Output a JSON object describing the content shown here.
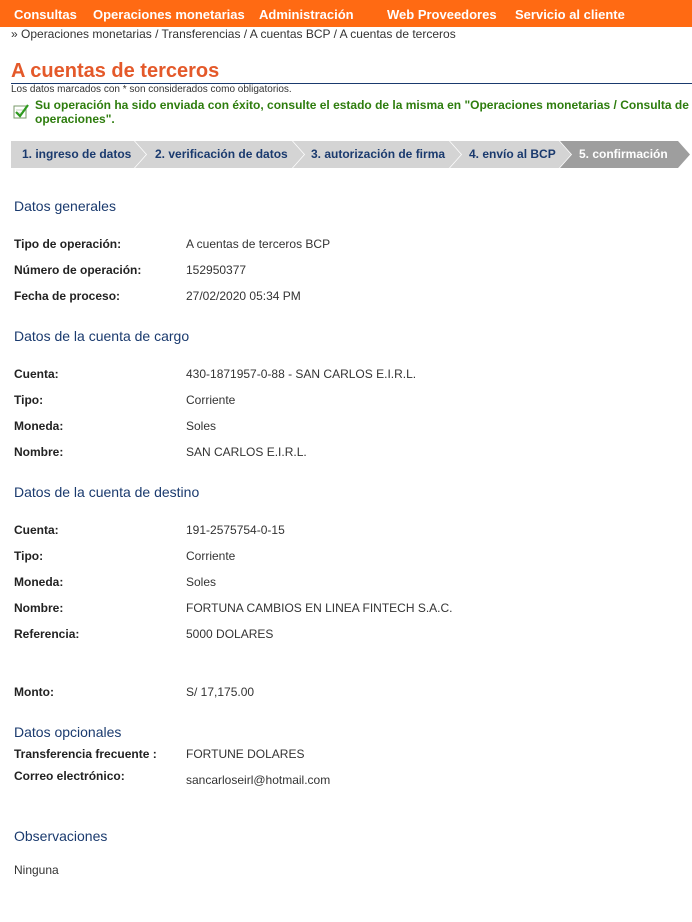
{
  "topnav": {
    "items": [
      "Consultas",
      "Operaciones monetarias",
      "Administración",
      "Web Proveedores",
      "Servicio al cliente"
    ]
  },
  "breadcrumb": "» Operaciones monetarias / Transferencias / A cuentas BCP / A cuentas de terceros",
  "page_title": "A cuentas de terceros",
  "required_note": "Los datos marcados con * son considerados como obligatorios.",
  "success": {
    "line1": "Su operación ha sido enviada con éxito, consulte el estado de la misma en \"Operaciones monetarias / Consulta de",
    "line2": "operaciones\"."
  },
  "steps": [
    "1. ingreso de datos",
    "2. verificación de datos",
    "3. autorización de firma",
    "4. envío al BCP",
    "5. confirmación"
  ],
  "colors": {
    "accent": "#ff6a13",
    "title": "#e4592a",
    "navy": "#1a3a6e",
    "success": "#2e7d0e",
    "step_inactive": "#d4d4d4",
    "step_active": "#9e9e9e"
  },
  "datos_generales": {
    "title": "Datos generales",
    "tipo_label": "Tipo de operación:",
    "tipo_value": "A cuentas de terceros BCP",
    "numero_label": "Número de operación:",
    "numero_value": "152950377",
    "fecha_label": "Fecha de proceso:",
    "fecha_value": "27/02/2020 05:34 PM"
  },
  "cuenta_cargo": {
    "title": "Datos de la cuenta de cargo",
    "cuenta_label": "Cuenta:",
    "cuenta_value": "430-1871957-0-88 - SAN CARLOS E.I.R.L.",
    "tipo_label": "Tipo:",
    "tipo_value": "Corriente",
    "moneda_label": "Moneda:",
    "moneda_value": "Soles",
    "nombre_label": "Nombre:",
    "nombre_value": "SAN CARLOS E.I.R.L."
  },
  "cuenta_destino": {
    "title": "Datos de la cuenta de destino",
    "cuenta_label": "Cuenta:",
    "cuenta_value": "191-2575754-0-15",
    "tipo_label": "Tipo:",
    "tipo_value": "Corriente",
    "moneda_label": "Moneda:",
    "moneda_value": "Soles",
    "nombre_label": "Nombre:",
    "nombre_value": "FORTUNA CAMBIOS EN LINEA FINTECH S.A.C.",
    "referencia_label": "Referencia:",
    "referencia_value": "5000 DOLARES"
  },
  "monto": {
    "label": "Monto:",
    "value": "S/ 17,175.00"
  },
  "opcionales": {
    "title": "Datos opcionales",
    "frecuente_label": "Transferencia frecuente :",
    "frecuente_value": "FORTUNE DOLARES",
    "correo_label": "Correo electrónico:",
    "correo_value": "sancarloseirl@hotmail.com"
  },
  "observaciones": {
    "title": "Observaciones",
    "value": "Ninguna"
  }
}
